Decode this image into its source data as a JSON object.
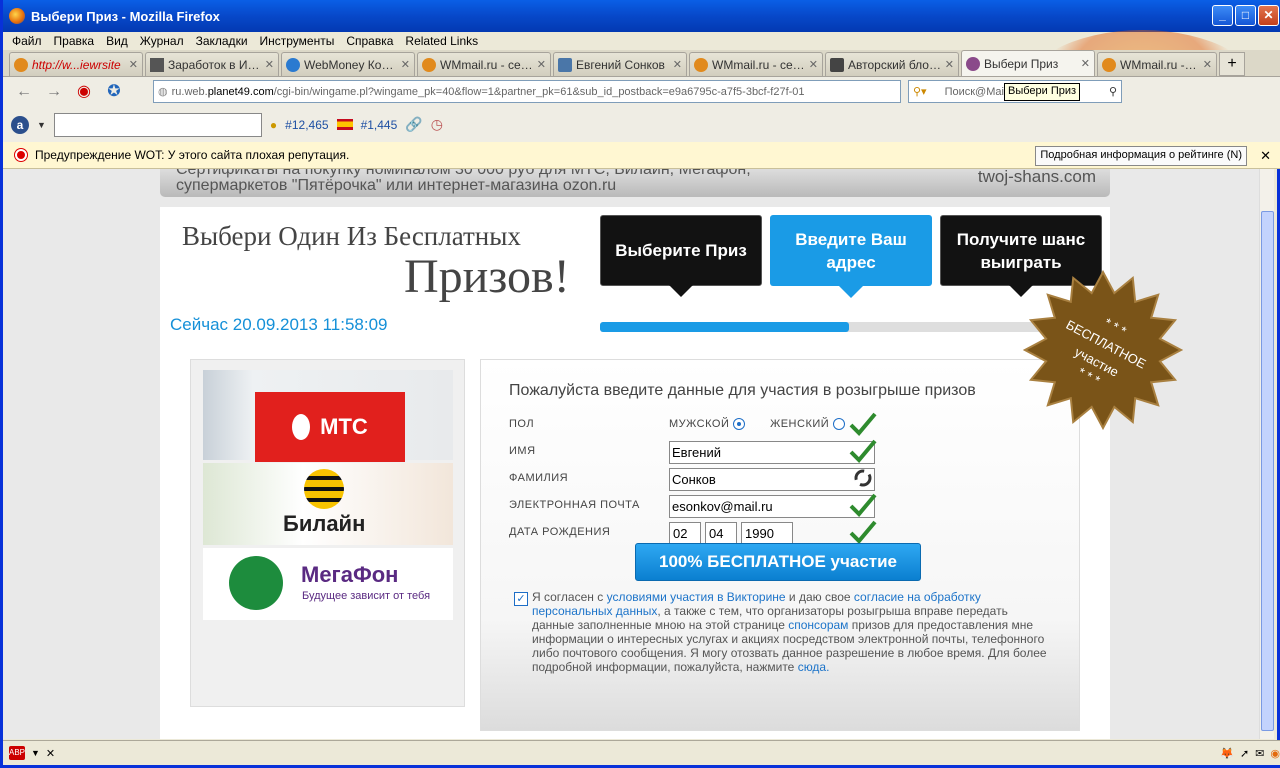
{
  "window": {
    "title": "Выбери Приз - Mozilla Firefox"
  },
  "menu": [
    "Файл",
    "Правка",
    "Вид",
    "Журнал",
    "Закладки",
    "Инструменты",
    "Справка",
    "Related Links"
  ],
  "tabs": [
    {
      "label": "http://w...iewrsite",
      "red": true
    },
    {
      "label": "Заработок в Ин..."
    },
    {
      "label": "WebMoney Кош..."
    },
    {
      "label": "WMmail.ru - серв..."
    },
    {
      "label": "Евгений Сонков"
    },
    {
      "label": "WMmail.ru - серв..."
    },
    {
      "label": "Авторский блог ..."
    },
    {
      "label": "Выбери Приз",
      "active": true
    },
    {
      "label": "WMmail.ru - серв..."
    }
  ],
  "url": {
    "prefix": "ru.web.",
    "host": "planet49.com",
    "rest": "/cgi-bin/wingame.pl?wingame_pk=40&flow=1&partner_pk=61&sub_id_postback=e9a6795c-a7f5-3bcf-f27f-01"
  },
  "search": {
    "placeholder": "Поиск@Mail"
  },
  "tooltip": "Выбери Приз",
  "toolbar2": {
    "rank1": "#12,465",
    "rank2": "#1,445"
  },
  "wot": {
    "warning": "Предупреждение WOT: У этого сайта плохая репутация.",
    "details_button": "Подробная информация о рейтинге (N)"
  },
  "page": {
    "banner_left": "Сертификаты на покупку номиналом 30 000 руб для МТС, Билайн, Мегафон, супермаркетов \"Пятёрочка\" или интернет-магазина ozon.ru",
    "banner_right": "twoj-shans.com",
    "headline1": "Выбери Один Из Бесплатных",
    "headline2": "Призов!",
    "now": "Сейчас 20.09.2013 11:58:09",
    "steps": [
      "Выберите Приз",
      "Введите Ваш адрес",
      "Получите шанс выиграть"
    ],
    "progress": 0.54,
    "badge": {
      "line1": "* * *",
      "line2": "БЕСПЛАТНОЕ",
      "line3": "участие",
      "line4": "* * *"
    },
    "brands": {
      "mts": "МТС",
      "beeline": "Билайн",
      "megafon": "МегаФон",
      "megafon_sub": "Будущее зависит от тебя"
    },
    "form": {
      "title": "Пожалуйста введите данные для участия в розыгрыше призов",
      "gender_label": "ПОЛ",
      "male": "МУЖСКОЙ",
      "female": "ЖЕНСКИЙ",
      "name_label": "ИМЯ",
      "name": "Евгений",
      "surname_label": "ФАМИЛИЯ",
      "surname": "Сонков",
      "email_label": "ЭЛЕКТРОННАЯ ПОЧТА",
      "email": "esonkov@mail.ru",
      "dob_label": "ДАТА РОЖДЕНИЯ",
      "dob_day": "02",
      "dob_month": "04",
      "dob_year": "1990",
      "submit": "100% БЕСПЛАТНОЕ участие",
      "consent": {
        "t1": "Я согласен с ",
        "l1": "условиями участия в Викторине",
        "t2": " и даю свое ",
        "l2": "согласие на обработку персональных данных",
        "t3": ", а также с тем, что организаторы розыгрыша вправе передать данные заполненные мною на этой странице ",
        "l3": "спонсорам",
        "t4": " призов для предоставления мне информации о интересных услугах и акциях посредством электронной почты, телефонного либо почтового сообщения. Я могу отозвать данное разрешение в любое время. Для более подробной информации, пожалуйста, нажмите ",
        "l4": "сюда."
      }
    }
  },
  "colors": {
    "accent": "#1a9be6",
    "check": "#2e8b2e",
    "wot_bg": "#fff7d2"
  }
}
